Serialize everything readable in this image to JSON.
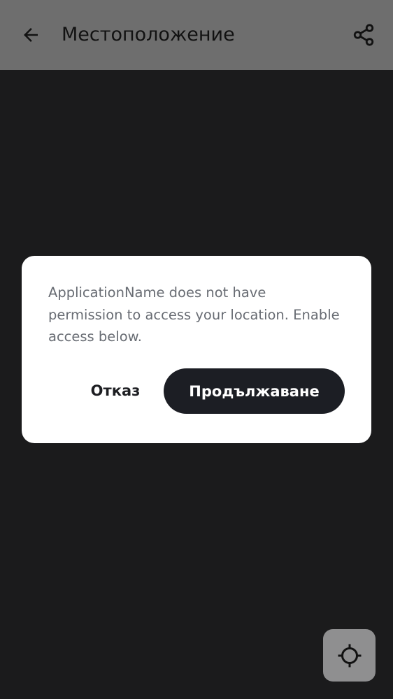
{
  "app_bar": {
    "back_icon": "arrow-left-icon",
    "title": "Местоположение",
    "share_icon": "share-icon"
  },
  "dialog": {
    "message": "ApplicationName does not have permission to access your location. Enable access below.",
    "cancel_label": "Отказ",
    "continue_label": "Продължаване"
  },
  "map_controls": {
    "locate_icon": "my-location-crosshair-icon"
  },
  "colors": {
    "app_bar_background": "#6e6e6e",
    "screen_background": "#1b1b1c",
    "dialog_background": "#ffffff",
    "primary_button": "#1c1e24",
    "message_text": "#686c73",
    "locate_button": "#8f8f90"
  }
}
